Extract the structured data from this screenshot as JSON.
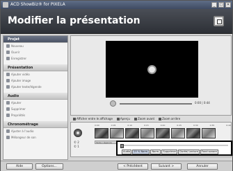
{
  "window": {
    "title": "ACD ShowBiz® for PIXELA",
    "controls": [
      "_",
      "□",
      "✕"
    ]
  },
  "header": {
    "title": "Modifier la présentation"
  },
  "sidebar": {
    "groups": [
      {
        "label": "Projet",
        "active": true,
        "items": [
          "Nouveau",
          "Ouvrir",
          "Enregistrer"
        ]
      },
      {
        "label": "Présentation",
        "active": false,
        "items": [
          "Ajouter vidéo",
          "Ajouter image",
          "Ajouter texte/légende"
        ]
      },
      {
        "label": "Audio",
        "active": false,
        "items": [
          "Ajouter",
          "Supprimer",
          "Propriétés"
        ]
      },
      {
        "label": "Chronométrage",
        "active": false,
        "items": [
          "Ajuster à l'audio",
          "Mélangeur de son"
        ]
      }
    ]
  },
  "preview": {
    "timecode": "0:00 | 0:44"
  },
  "toolbar": {
    "items": [
      "Afficher entre le affichage",
      "Aperçu",
      "Zoom avant",
      "Zoom arrière"
    ]
  },
  "timeline": {
    "ruler": [
      "0:00",
      "0:05",
      "0:10",
      "0:15",
      "0:20",
      "0:25",
      "0:30",
      "0:35",
      "0:40"
    ],
    "track_labels": [
      "© 2",
      "© 1"
    ],
    "caption_clip": "Texte / légende"
  },
  "popup": {
    "buttons": [
      "Audio",
      "25 % Norm.",
      "Norm.",
      "Supprimer",
      "Durée/ Lecture",
      "Fond sonore"
    ],
    "active_index": 1
  },
  "bottom": {
    "help": "Aide",
    "options": "Options...",
    "previous": "< Précédent",
    "next": "Suivant >",
    "cancel": "Annuler"
  },
  "colors": {
    "header": "#3a3d44",
    "sidebar_active": "#5a6273",
    "popup_border": "#000000"
  }
}
